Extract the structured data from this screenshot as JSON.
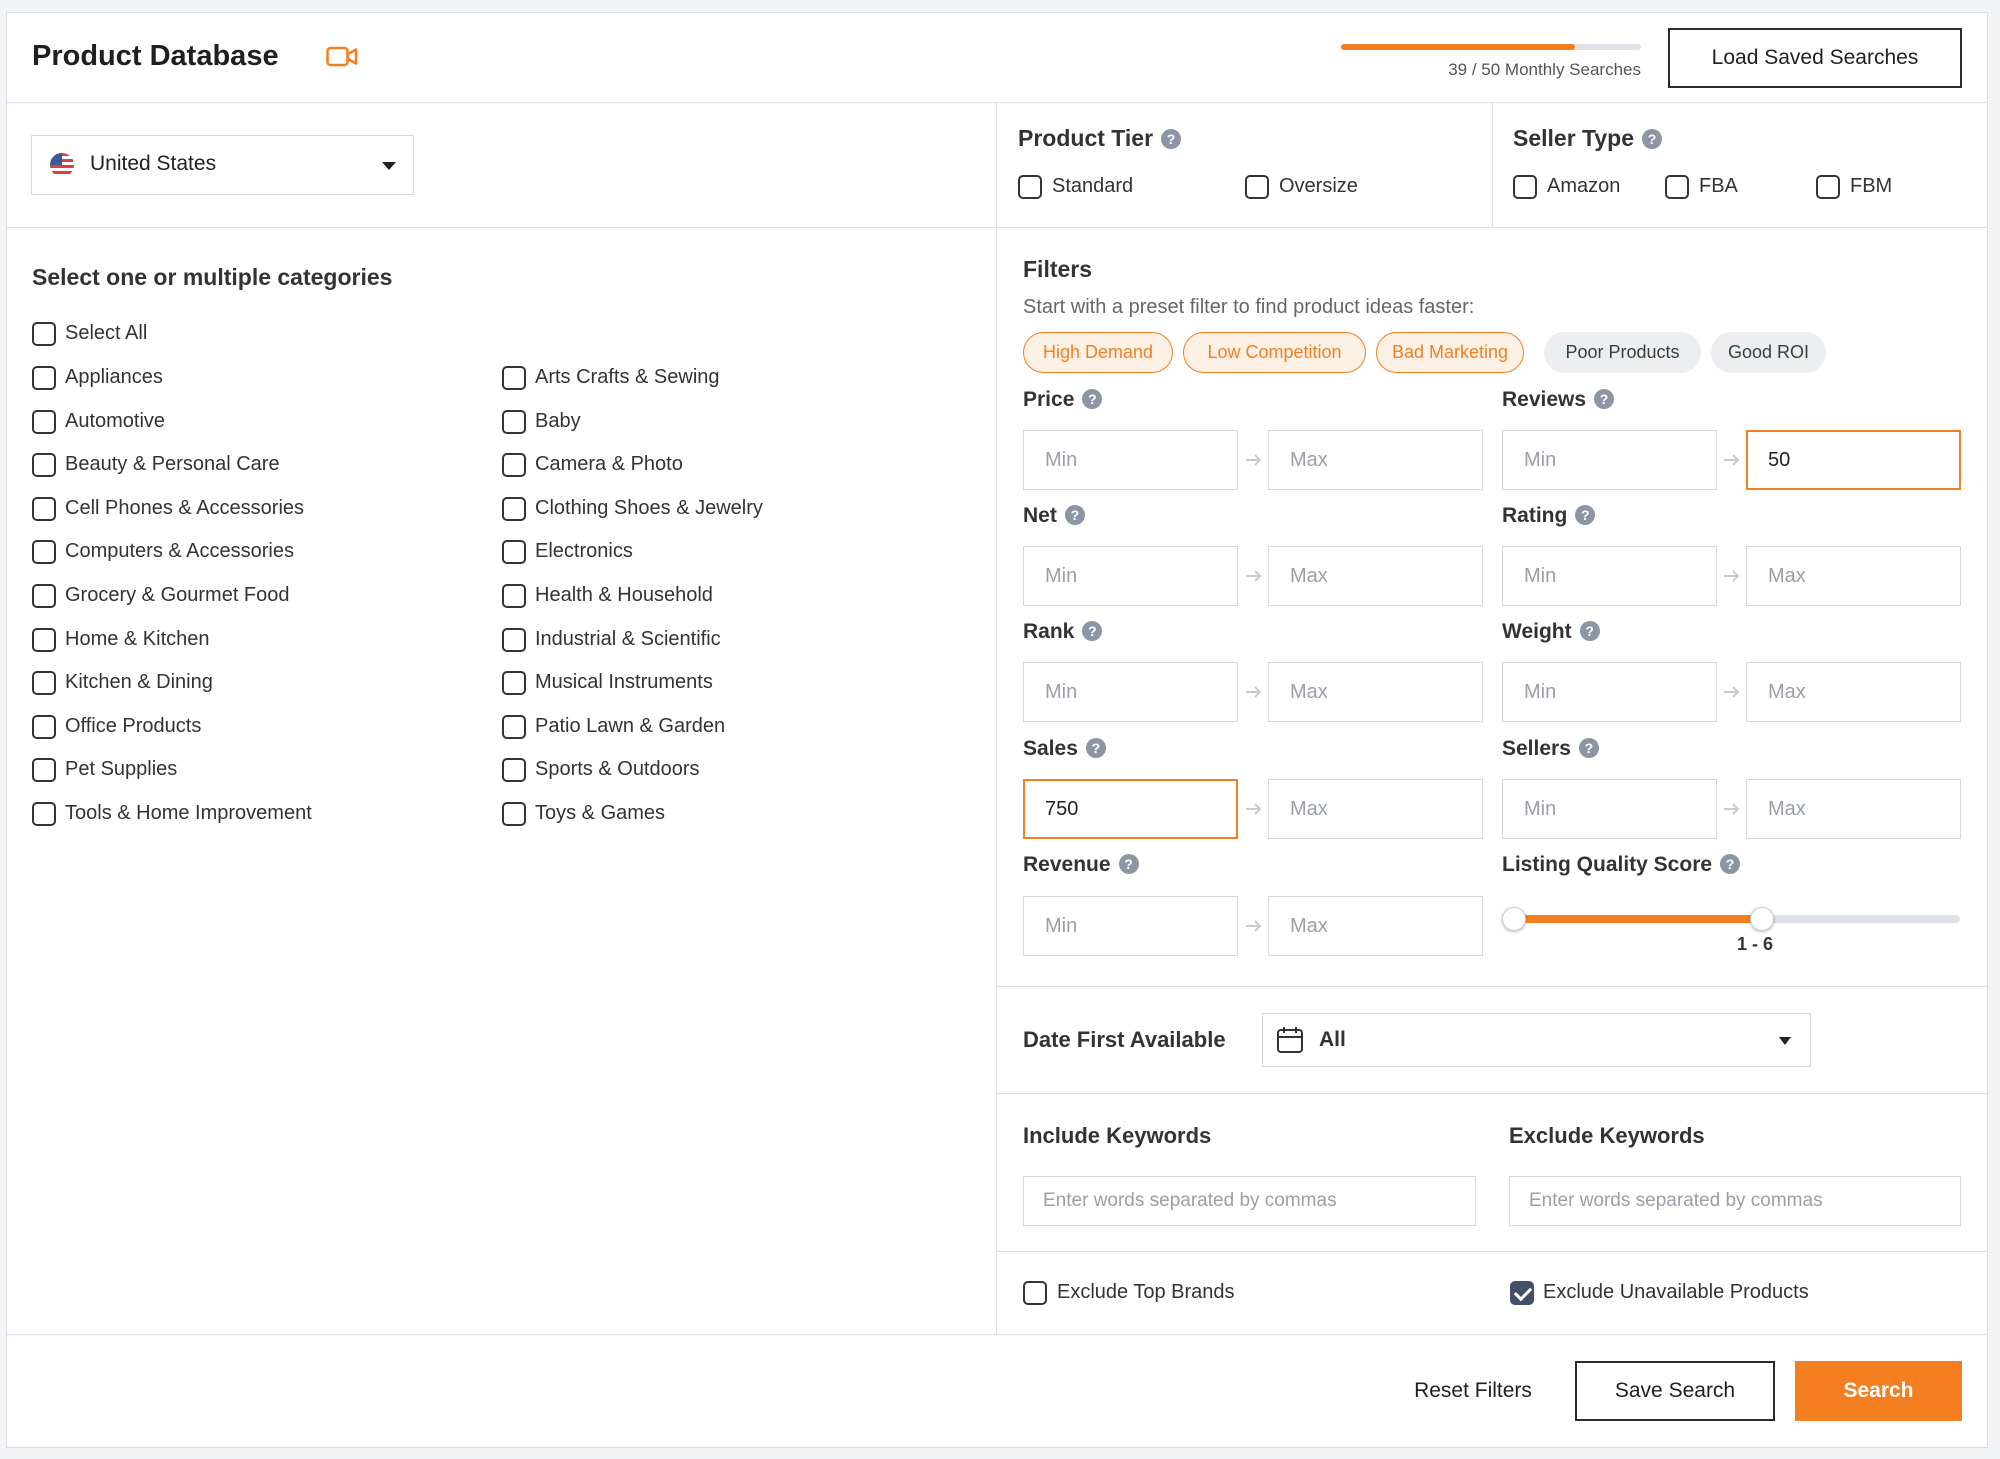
{
  "header": {
    "title": "Product Database",
    "usage_text": "39 / 50 Monthly Searches",
    "usage_used": 39,
    "usage_limit": 50,
    "load_saved_label": "Load Saved Searches"
  },
  "country": {
    "selected": "United States"
  },
  "product_tier": {
    "title": "Product Tier",
    "options": [
      {
        "label": "Standard",
        "checked": false
      },
      {
        "label": "Oversize",
        "checked": false
      }
    ]
  },
  "seller_type": {
    "title": "Seller Type",
    "options": [
      {
        "label": "Amazon",
        "checked": false
      },
      {
        "label": "FBA",
        "checked": false
      },
      {
        "label": "FBM",
        "checked": false
      }
    ]
  },
  "categories": {
    "title": "Select one or multiple categories",
    "select_all": "Select All",
    "left": [
      "Appliances",
      "Automotive",
      "Beauty & Personal Care",
      "Cell Phones & Accessories",
      "Computers & Accessories",
      "Grocery & Gourmet Food",
      "Home & Kitchen",
      "Kitchen & Dining",
      "Office Products",
      "Pet Supplies",
      "Tools & Home Improvement"
    ],
    "right": [
      "Arts Crafts & Sewing",
      "Baby",
      "Camera & Photo",
      "Clothing Shoes & Jewelry",
      "Electronics",
      "Health & Household",
      "Industrial & Scientific",
      "Musical Instruments",
      "Patio Lawn & Garden",
      "Sports & Outdoors",
      "Toys & Games"
    ]
  },
  "filters": {
    "title": "Filters",
    "subtitle": "Start with a preset filter to find product ideas faster:",
    "presets": [
      {
        "label": "High Demand",
        "active": true
      },
      {
        "label": "Low Competition",
        "active": true
      },
      {
        "label": "Bad Marketing",
        "active": true
      },
      {
        "label": "Poor Products",
        "active": false
      },
      {
        "label": "Good ROI",
        "active": false
      }
    ],
    "min_placeholder": "Min",
    "max_placeholder": "Max",
    "ranges": {
      "price": {
        "label": "Price",
        "min": "",
        "max": ""
      },
      "reviews": {
        "label": "Reviews",
        "min": "",
        "max": "50"
      },
      "net": {
        "label": "Net",
        "min": "",
        "max": ""
      },
      "rating": {
        "label": "Rating",
        "min": "",
        "max": ""
      },
      "rank": {
        "label": "Rank",
        "min": "",
        "max": ""
      },
      "weight": {
        "label": "Weight",
        "min": "",
        "max": ""
      },
      "sales": {
        "label": "Sales",
        "min": "750",
        "max": ""
      },
      "sellers": {
        "label": "Sellers",
        "min": "",
        "max": ""
      },
      "revenue": {
        "label": "Revenue",
        "min": "",
        "max": ""
      }
    },
    "lqs": {
      "label": "Listing Quality Score",
      "min": 1,
      "max": 6,
      "scale_max": 10,
      "text": "1 - 6"
    }
  },
  "date_first_available": {
    "label": "Date First Available",
    "selected": "All"
  },
  "keywords": {
    "include_label": "Include Keywords",
    "exclude_label": "Exclude Keywords",
    "placeholder": "Enter words separated by commas"
  },
  "exclusions": {
    "top_brands": {
      "label": "Exclude Top Brands",
      "checked": false
    },
    "unavailable": {
      "label": "Exclude Unavailable Products",
      "checked": true
    }
  },
  "footer": {
    "reset_label": "Reset Filters",
    "save_label": "Save Search",
    "search_label": "Search"
  },
  "colors": {
    "accent": "#f47f20",
    "border": "#d9dce0",
    "checked": "#43506a"
  }
}
